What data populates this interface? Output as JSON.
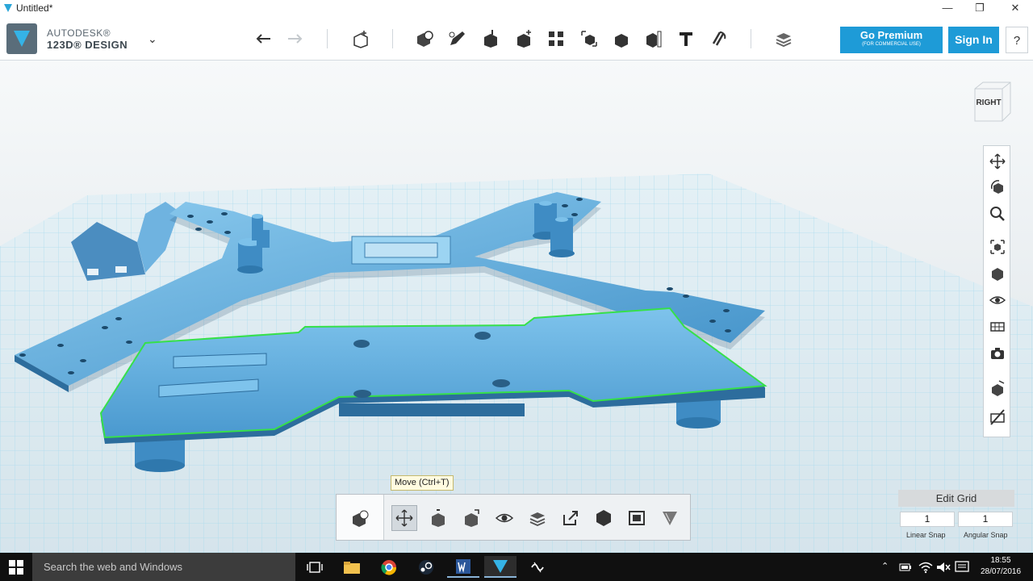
{
  "window": {
    "title": "Untitled*"
  },
  "brand": {
    "line1": "AUTODESK®",
    "line2": "123D® DESIGN"
  },
  "toolbar": {
    "undo_icon": "undo-arrow-icon",
    "redo_icon": "redo-arrow-icon",
    "premium_label": "Go Premium",
    "premium_sub": "(FOR COMMERCIAL USE)",
    "signin_label": "Sign In",
    "help_label": "?"
  },
  "viewcube": {
    "face": "RIGHT"
  },
  "tooltip": {
    "text": "Move (Ctrl+T)"
  },
  "edit_grid": {
    "title": "Edit Grid",
    "linear_value": "1",
    "angular_value": "1",
    "linear_label": "Linear Snap",
    "angular_label": "Angular Snap"
  },
  "taskbar": {
    "search_placeholder": "Search the web and Windows",
    "time": "18:55",
    "date": "28/07/2016"
  },
  "colors": {
    "accent": "#1e9bd7",
    "model": "#4ea3d8",
    "selection": "#36e04a",
    "grid": "#8fd0e8"
  }
}
